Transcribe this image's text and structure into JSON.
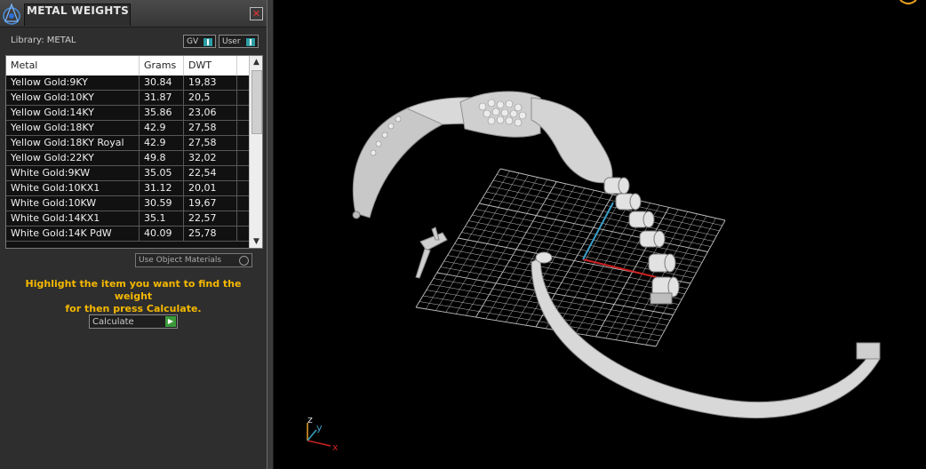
{
  "panel": {
    "title": "METAL WEIGHTS",
    "library_label": "Library: METAL",
    "library_buttons": [
      "GV",
      "User"
    ],
    "columns": [
      "Metal",
      "Grams",
      "DWT"
    ],
    "rows": [
      [
        "Yellow Gold:9KY",
        "30.84",
        "19,83"
      ],
      [
        "Yellow Gold:10KY",
        "31.87",
        "20,5"
      ],
      [
        "Yellow Gold:14KY",
        "35.86",
        "23,06"
      ],
      [
        "Yellow Gold:18KY",
        "42.9",
        "27,58"
      ],
      [
        "Yellow Gold:18KY Royal",
        "42.9",
        "27,58"
      ],
      [
        "Yellow Gold:22KY",
        "49.8",
        "32,02"
      ],
      [
        "White Gold:9KW",
        "35.05",
        "22,54"
      ],
      [
        "White Gold:10KX1",
        "31.12",
        "20,01"
      ],
      [
        "White Gold:10KW",
        "30.59",
        "19,67"
      ],
      [
        "White Gold:14KX1",
        "35.1",
        "22,57"
      ],
      [
        "White Gold:14K PdW",
        "40.09",
        "25,78"
      ]
    ],
    "use_object_materials_label": "Use Object Materials",
    "hint_line1": "Highlight the item you want to find the weight",
    "hint_line2": "for then press Calculate.",
    "calculate_label": "Calculate",
    "close_symbol": "✕"
  },
  "viewport": {
    "axis_labels": {
      "x": "x",
      "y": "y",
      "z": "z"
    },
    "colors": {
      "background": "#000000",
      "grid": "#bfbfbf",
      "x_axis": "#cc2222",
      "y_axis": "#3aa0c8",
      "model": "#d6d6d6"
    }
  }
}
